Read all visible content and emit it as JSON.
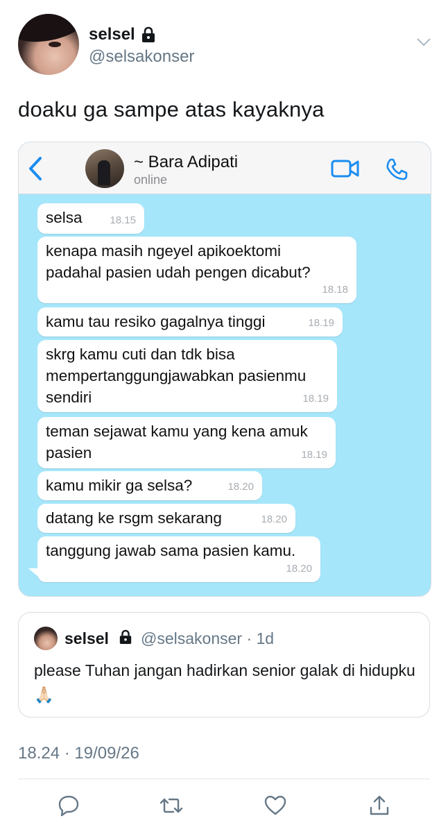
{
  "user": {
    "display_name": "selsel",
    "handle": "@selsakonser",
    "locked_icon": "lock-icon"
  },
  "tweet": {
    "text": "doaku ga sampe atas kayaknya",
    "timestamp": "18.24 · 19/09/26"
  },
  "chat": {
    "contact_name": "~ Bara Adipati",
    "contact_status": "online",
    "messages": [
      {
        "text": "selsa",
        "time": "18.15"
      },
      {
        "text": "kenapa masih ngeyel apikoektomi\npadahal pasien udah pengen dicabut?",
        "time": "18.18"
      },
      {
        "text": "kamu tau resiko gagalnya tinggi",
        "time": "18.19"
      },
      {
        "text": "skrg kamu cuti dan tdk bisa\nmempertanggungjawabkan pasienmu\nsendiri",
        "time": "18.19"
      },
      {
        "text": "teman sejawat kamu yang kena amuk\npasien",
        "time": "18.19"
      },
      {
        "text": "kamu mikir ga selsa?",
        "time": "18.20"
      },
      {
        "text": "datang ke rsgm sekarang",
        "time": "18.20"
      },
      {
        "text": "tanggung jawab sama pasien kamu.",
        "time": "18.20"
      }
    ],
    "colors": {
      "background": "#a6e6fb",
      "accent": "#1a8cf0"
    }
  },
  "quote": {
    "display_name": "selsel",
    "handle_time": "@selsakonser · 1d",
    "text": "please Tuhan jangan hadirkan senior galak di hidupku 🙏🏻"
  },
  "actions": [
    "reply-icon",
    "retweet-icon",
    "like-icon",
    "share-icon"
  ]
}
